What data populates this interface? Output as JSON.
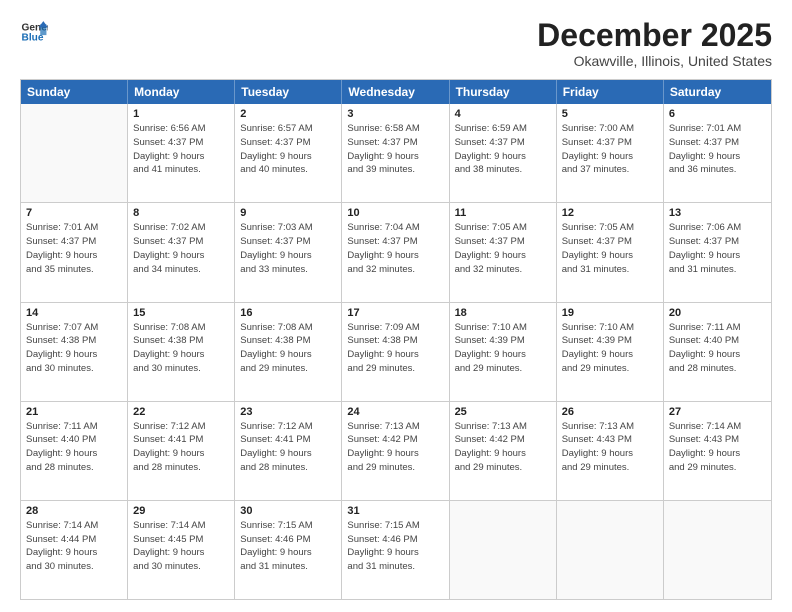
{
  "header": {
    "logo_line1": "General",
    "logo_line2": "Blue",
    "main_title": "December 2025",
    "subtitle": "Okawville, Illinois, United States"
  },
  "days_of_week": [
    "Sunday",
    "Monday",
    "Tuesday",
    "Wednesday",
    "Thursday",
    "Friday",
    "Saturday"
  ],
  "weeks": [
    [
      {
        "num": "",
        "lines": []
      },
      {
        "num": "1",
        "lines": [
          "Sunrise: 6:56 AM",
          "Sunset: 4:37 PM",
          "Daylight: 9 hours",
          "and 41 minutes."
        ]
      },
      {
        "num": "2",
        "lines": [
          "Sunrise: 6:57 AM",
          "Sunset: 4:37 PM",
          "Daylight: 9 hours",
          "and 40 minutes."
        ]
      },
      {
        "num": "3",
        "lines": [
          "Sunrise: 6:58 AM",
          "Sunset: 4:37 PM",
          "Daylight: 9 hours",
          "and 39 minutes."
        ]
      },
      {
        "num": "4",
        "lines": [
          "Sunrise: 6:59 AM",
          "Sunset: 4:37 PM",
          "Daylight: 9 hours",
          "and 38 minutes."
        ]
      },
      {
        "num": "5",
        "lines": [
          "Sunrise: 7:00 AM",
          "Sunset: 4:37 PM",
          "Daylight: 9 hours",
          "and 37 minutes."
        ]
      },
      {
        "num": "6",
        "lines": [
          "Sunrise: 7:01 AM",
          "Sunset: 4:37 PM",
          "Daylight: 9 hours",
          "and 36 minutes."
        ]
      }
    ],
    [
      {
        "num": "7",
        "lines": [
          "Sunrise: 7:01 AM",
          "Sunset: 4:37 PM",
          "Daylight: 9 hours",
          "and 35 minutes."
        ]
      },
      {
        "num": "8",
        "lines": [
          "Sunrise: 7:02 AM",
          "Sunset: 4:37 PM",
          "Daylight: 9 hours",
          "and 34 minutes."
        ]
      },
      {
        "num": "9",
        "lines": [
          "Sunrise: 7:03 AM",
          "Sunset: 4:37 PM",
          "Daylight: 9 hours",
          "and 33 minutes."
        ]
      },
      {
        "num": "10",
        "lines": [
          "Sunrise: 7:04 AM",
          "Sunset: 4:37 PM",
          "Daylight: 9 hours",
          "and 32 minutes."
        ]
      },
      {
        "num": "11",
        "lines": [
          "Sunrise: 7:05 AM",
          "Sunset: 4:37 PM",
          "Daylight: 9 hours",
          "and 32 minutes."
        ]
      },
      {
        "num": "12",
        "lines": [
          "Sunrise: 7:05 AM",
          "Sunset: 4:37 PM",
          "Daylight: 9 hours",
          "and 31 minutes."
        ]
      },
      {
        "num": "13",
        "lines": [
          "Sunrise: 7:06 AM",
          "Sunset: 4:37 PM",
          "Daylight: 9 hours",
          "and 31 minutes."
        ]
      }
    ],
    [
      {
        "num": "14",
        "lines": [
          "Sunrise: 7:07 AM",
          "Sunset: 4:38 PM",
          "Daylight: 9 hours",
          "and 30 minutes."
        ]
      },
      {
        "num": "15",
        "lines": [
          "Sunrise: 7:08 AM",
          "Sunset: 4:38 PM",
          "Daylight: 9 hours",
          "and 30 minutes."
        ]
      },
      {
        "num": "16",
        "lines": [
          "Sunrise: 7:08 AM",
          "Sunset: 4:38 PM",
          "Daylight: 9 hours",
          "and 29 minutes."
        ]
      },
      {
        "num": "17",
        "lines": [
          "Sunrise: 7:09 AM",
          "Sunset: 4:38 PM",
          "Daylight: 9 hours",
          "and 29 minutes."
        ]
      },
      {
        "num": "18",
        "lines": [
          "Sunrise: 7:10 AM",
          "Sunset: 4:39 PM",
          "Daylight: 9 hours",
          "and 29 minutes."
        ]
      },
      {
        "num": "19",
        "lines": [
          "Sunrise: 7:10 AM",
          "Sunset: 4:39 PM",
          "Daylight: 9 hours",
          "and 29 minutes."
        ]
      },
      {
        "num": "20",
        "lines": [
          "Sunrise: 7:11 AM",
          "Sunset: 4:40 PM",
          "Daylight: 9 hours",
          "and 28 minutes."
        ]
      }
    ],
    [
      {
        "num": "21",
        "lines": [
          "Sunrise: 7:11 AM",
          "Sunset: 4:40 PM",
          "Daylight: 9 hours",
          "and 28 minutes."
        ]
      },
      {
        "num": "22",
        "lines": [
          "Sunrise: 7:12 AM",
          "Sunset: 4:41 PM",
          "Daylight: 9 hours",
          "and 28 minutes."
        ]
      },
      {
        "num": "23",
        "lines": [
          "Sunrise: 7:12 AM",
          "Sunset: 4:41 PM",
          "Daylight: 9 hours",
          "and 28 minutes."
        ]
      },
      {
        "num": "24",
        "lines": [
          "Sunrise: 7:13 AM",
          "Sunset: 4:42 PM",
          "Daylight: 9 hours",
          "and 29 minutes."
        ]
      },
      {
        "num": "25",
        "lines": [
          "Sunrise: 7:13 AM",
          "Sunset: 4:42 PM",
          "Daylight: 9 hours",
          "and 29 minutes."
        ]
      },
      {
        "num": "26",
        "lines": [
          "Sunrise: 7:13 AM",
          "Sunset: 4:43 PM",
          "Daylight: 9 hours",
          "and 29 minutes."
        ]
      },
      {
        "num": "27",
        "lines": [
          "Sunrise: 7:14 AM",
          "Sunset: 4:43 PM",
          "Daylight: 9 hours",
          "and 29 minutes."
        ]
      }
    ],
    [
      {
        "num": "28",
        "lines": [
          "Sunrise: 7:14 AM",
          "Sunset: 4:44 PM",
          "Daylight: 9 hours",
          "and 30 minutes."
        ]
      },
      {
        "num": "29",
        "lines": [
          "Sunrise: 7:14 AM",
          "Sunset: 4:45 PM",
          "Daylight: 9 hours",
          "and 30 minutes."
        ]
      },
      {
        "num": "30",
        "lines": [
          "Sunrise: 7:15 AM",
          "Sunset: 4:46 PM",
          "Daylight: 9 hours",
          "and 31 minutes."
        ]
      },
      {
        "num": "31",
        "lines": [
          "Sunrise: 7:15 AM",
          "Sunset: 4:46 PM",
          "Daylight: 9 hours",
          "and 31 minutes."
        ]
      },
      {
        "num": "",
        "lines": []
      },
      {
        "num": "",
        "lines": []
      },
      {
        "num": "",
        "lines": []
      }
    ]
  ]
}
